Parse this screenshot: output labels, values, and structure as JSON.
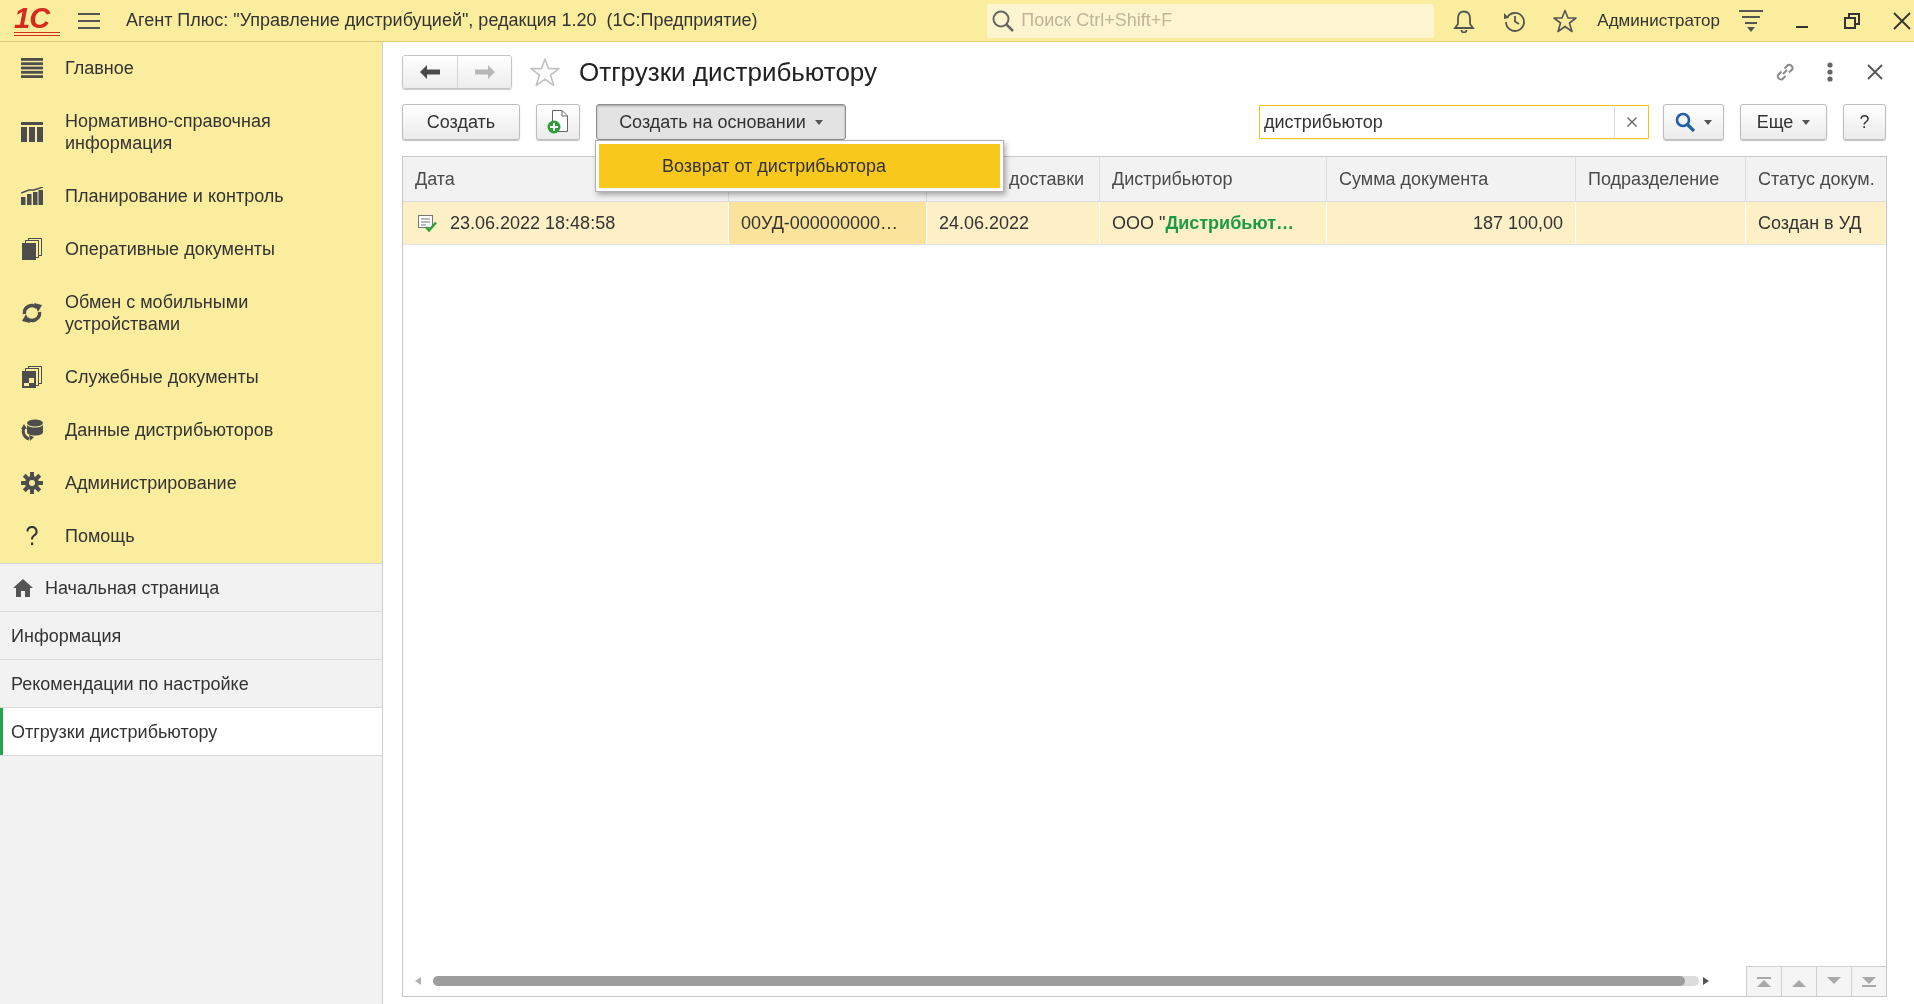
{
  "window": {
    "logo": "1С",
    "title": "Агент Плюс: \"Управление дистрибуцией\", редакция 1.20  (1С:Предприятие)",
    "search": {
      "placeholder": "Поиск Ctrl+Shift+F"
    },
    "user": "Администратор"
  },
  "sections": [
    {
      "label": "Главное",
      "selected": false
    },
    {
      "label": "Нормативно-справочная информация",
      "selected": false
    },
    {
      "label": "Планирование и контроль",
      "selected": false
    },
    {
      "label": "Оперативные документы",
      "selected": false
    },
    {
      "label": "Обмен с мобильными устройствами",
      "selected": false
    },
    {
      "label": "Служебные документы",
      "selected": false
    },
    {
      "label": "Данные дистрибьюторов",
      "selected": false
    },
    {
      "label": "Администрирование",
      "selected": false
    },
    {
      "label": "Помощь",
      "selected": false
    }
  ],
  "open_windows": [
    {
      "kind": "home",
      "label": "Начальная страница",
      "selected": false
    },
    {
      "kind": "page",
      "label": "Информация",
      "selected": false
    },
    {
      "kind": "page",
      "label": "Рекомендации по настройке",
      "selected": false
    },
    {
      "kind": "page",
      "label": "Отгрузки дистрибьютору",
      "selected": true
    }
  ],
  "form": {
    "title": "Отгрузки дистрибьютору",
    "favorite": false,
    "navigation": [
      {
        "kind": "back",
        "disabled": false
      },
      {
        "kind": "forward",
        "disabled": true
      }
    ],
    "toolbar": {
      "create": "Создать",
      "create_based_on": {
        "label": "Создать на основании",
        "expanded": true,
        "menu": [
          {
            "label": "Возврат от дистрибьютора",
            "selected": true
          }
        ]
      },
      "search": {
        "value": "дистрибьютор"
      },
      "more": "Еще",
      "help": "?"
    },
    "table": {
      "columns": [
        {
          "kind": "text",
          "label": "Дата"
        },
        {
          "kind": "text"
        },
        {
          "kind": "text",
          "label": "доставки"
        },
        {
          "kind": "text",
          "label": "Дистрибьютор"
        },
        {
          "kind": "number",
          "label": "Сумма документа"
        },
        {
          "kind": "text",
          "label": "Подразделение"
        },
        {
          "kind": "text",
          "label": "Статус докум."
        }
      ],
      "rows": [
        {
          "selected": true,
          "cells": [
            {
              "text": "23.06.2022 18:48:58",
              "current": false
            },
            {
              "text": "00УД-000000000…",
              "current": true
            },
            {
              "text": "24.06.2022",
              "current": false
            },
            {
              "text": "ООО \"**Дистрибьют…**",
              "current": false
            },
            {
              "text": "187 100,00",
              "current": false
            },
            {
              "text": "",
              "current": false
            },
            {
              "text": "Создан в УД",
              "current": false
            }
          ]
        }
      ]
    }
  }
}
